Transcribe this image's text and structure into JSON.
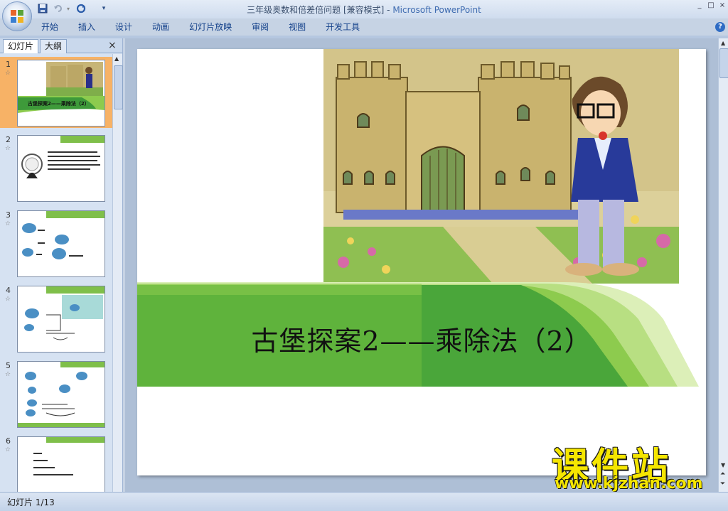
{
  "window": {
    "title_doc": "三年级奥数和倍差倍问题 [兼容模式]",
    "title_sep": " - ",
    "title_app": "Microsoft PowerPoint",
    "controls": [
      "_",
      "□",
      "×"
    ]
  },
  "qat": {
    "icons": [
      "save-icon",
      "undo-icon",
      "redo-icon",
      "customize-icon"
    ]
  },
  "ribbon": {
    "tabs": [
      "开始",
      "插入",
      "设计",
      "动画",
      "幻灯片放映",
      "审阅",
      "视图",
      "开发工具"
    ],
    "help": "?"
  },
  "pane": {
    "tab_slides": "幻灯片",
    "tab_outline": "大纲",
    "close": "×",
    "thumbnails": [
      {
        "num": "1",
        "selected": true,
        "caption": "古堡探案2——乘除法（2）"
      },
      {
        "num": "2",
        "selected": false,
        "caption": ""
      },
      {
        "num": "3",
        "selected": false,
        "caption": ""
      },
      {
        "num": "4",
        "selected": false,
        "caption": ""
      },
      {
        "num": "5",
        "selected": false,
        "caption": ""
      },
      {
        "num": "6",
        "selected": false,
        "caption": ""
      }
    ],
    "star": "☆"
  },
  "slide": {
    "title": "古堡探案2——乘除法（2）"
  },
  "status": {
    "text": "幻灯片 1/13"
  },
  "watermark": {
    "line1": "课件站",
    "line2": "www.kjzhan.com"
  },
  "colors": {
    "band_dark": "#3e9a3a",
    "band_light": "#8dcb4e",
    "selected": "#f7b266"
  }
}
